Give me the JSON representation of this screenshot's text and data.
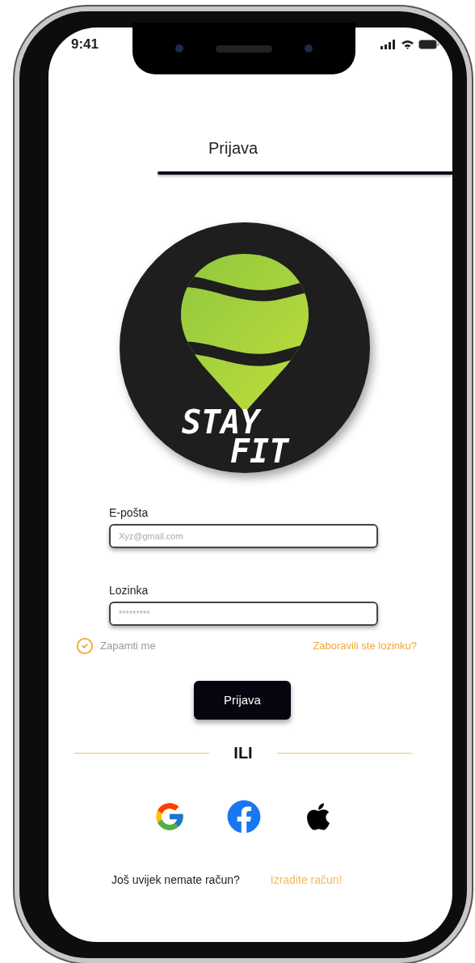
{
  "status_bar": {
    "time": "9:41"
  },
  "header": {
    "title": "Prijava"
  },
  "logo": {
    "words": [
      "STAY",
      "FIT"
    ]
  },
  "fields": [
    {
      "label": "E-pošta",
      "placeholder": "Xyz@gmail.com"
    },
    {
      "label": "Lozinka",
      "placeholder": "*********"
    }
  ],
  "remember": {
    "label": "Zapamti me",
    "checked": true
  },
  "forgot_link": "Zaboravili ste lozinku?",
  "submit_button": "Prijava",
  "divider": "ILI",
  "social_logins": [
    {
      "kind": "google"
    },
    {
      "kind": "facebook"
    },
    {
      "kind": "apple"
    }
  ],
  "footer": {
    "prompt": "Još uvijek nemate račun?",
    "link": "Izradite račun!"
  }
}
